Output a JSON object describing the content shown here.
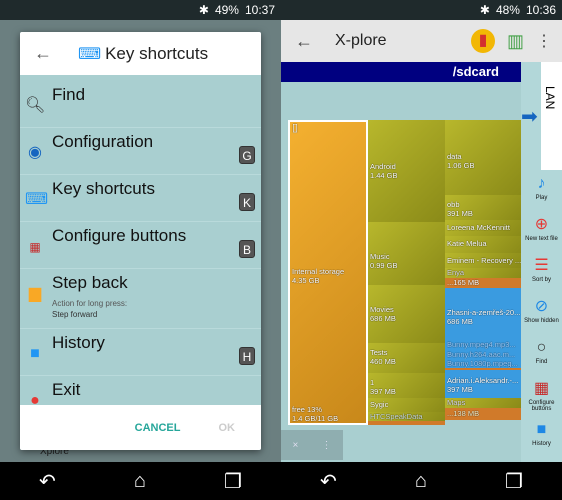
{
  "left": {
    "status": {
      "battery": "49%",
      "time": "10:37"
    },
    "dialog": {
      "title": "Key shortcuts",
      "items": [
        {
          "label": "Find",
          "icon": "search-icon",
          "key": ""
        },
        {
          "label": "Configuration",
          "icon": "gear-icon",
          "key": "G"
        },
        {
          "label": "Key shortcuts",
          "icon": "keyboard-icon",
          "key": "K"
        },
        {
          "label": "Configure buttons",
          "icon": "buttons-icon",
          "key": "B"
        },
        {
          "label": "Step back",
          "icon": "folder-back-icon",
          "key": "",
          "sub_label": "Action for long press:",
          "sub_value": "Step forward"
        },
        {
          "label": "History",
          "icon": "history-icon",
          "key": "H"
        },
        {
          "label": "Exit",
          "icon": "exit-icon",
          "key": ""
        }
      ],
      "cancel": "CANCEL",
      "ok": "OK"
    },
    "background_item": "Xplore"
  },
  "right": {
    "status": {
      "battery": "48%",
      "time": "10:36"
    },
    "app_title": "X-plore",
    "path": "/sdcard",
    "lan_label": "LAN",
    "treemap": {
      "root": {
        "name": "Internal storage",
        "size": "4.35 GB",
        "free": "free 13%",
        "usage": "1.4 GB/11 GB"
      },
      "folders": [
        {
          "name": "Android",
          "size": "1.44 GB"
        },
        {
          "name": "Music",
          "size": "0.99 GB"
        },
        {
          "name": "Movies",
          "size": "686 MB"
        },
        {
          "name": "Tests",
          "size": "460 MB"
        },
        {
          "name": "1",
          "size": "397 MB"
        },
        {
          "name": "Sygic",
          "size": ""
        },
        {
          "name": "HTCSpeakData",
          "size": ""
        }
      ],
      "children": [
        {
          "name": "data",
          "size": "1.06 GB"
        },
        {
          "name": "obb",
          "size": "391 MB"
        },
        {
          "name": "Loreena McKennitt"
        },
        {
          "name": "Katie Melua"
        },
        {
          "name": "Eminem - Recovery ..."
        },
        {
          "name": "Enya"
        },
        {
          "name": "...165 MB"
        },
        {
          "name": "Zhasni-a-zemřeš-20...",
          "size": "686 MB"
        },
        {
          "name": "Bunny.mpeg4.mp3..."
        },
        {
          "name": "Bunny.h264.aac.m..."
        },
        {
          "name": "Bunny.1080p.mpeg..."
        },
        {
          "name": "Adrian.i.Aleksandr.-...",
          "size": "397 MB"
        },
        {
          "name": "Maps"
        },
        {
          "name": "...138 MB"
        }
      ]
    },
    "tab": {
      "close": "×",
      "menu": "⋮"
    },
    "sidebar": [
      {
        "label": "Play",
        "icon": "play-icon"
      },
      {
        "label": "New text file",
        "icon": "new-file-icon"
      },
      {
        "label": "Sort by",
        "icon": "sort-icon"
      },
      {
        "label": "Show hidden",
        "icon": "eye-icon"
      },
      {
        "label": "Find",
        "icon": "search-icon"
      },
      {
        "label": "Configure buttons",
        "icon": "buttons-icon"
      },
      {
        "label": "History",
        "icon": "history-icon"
      }
    ]
  },
  "colors": {
    "accent": "#26a69a",
    "path_bar": "#000080",
    "panel": "#a9cfd0"
  }
}
